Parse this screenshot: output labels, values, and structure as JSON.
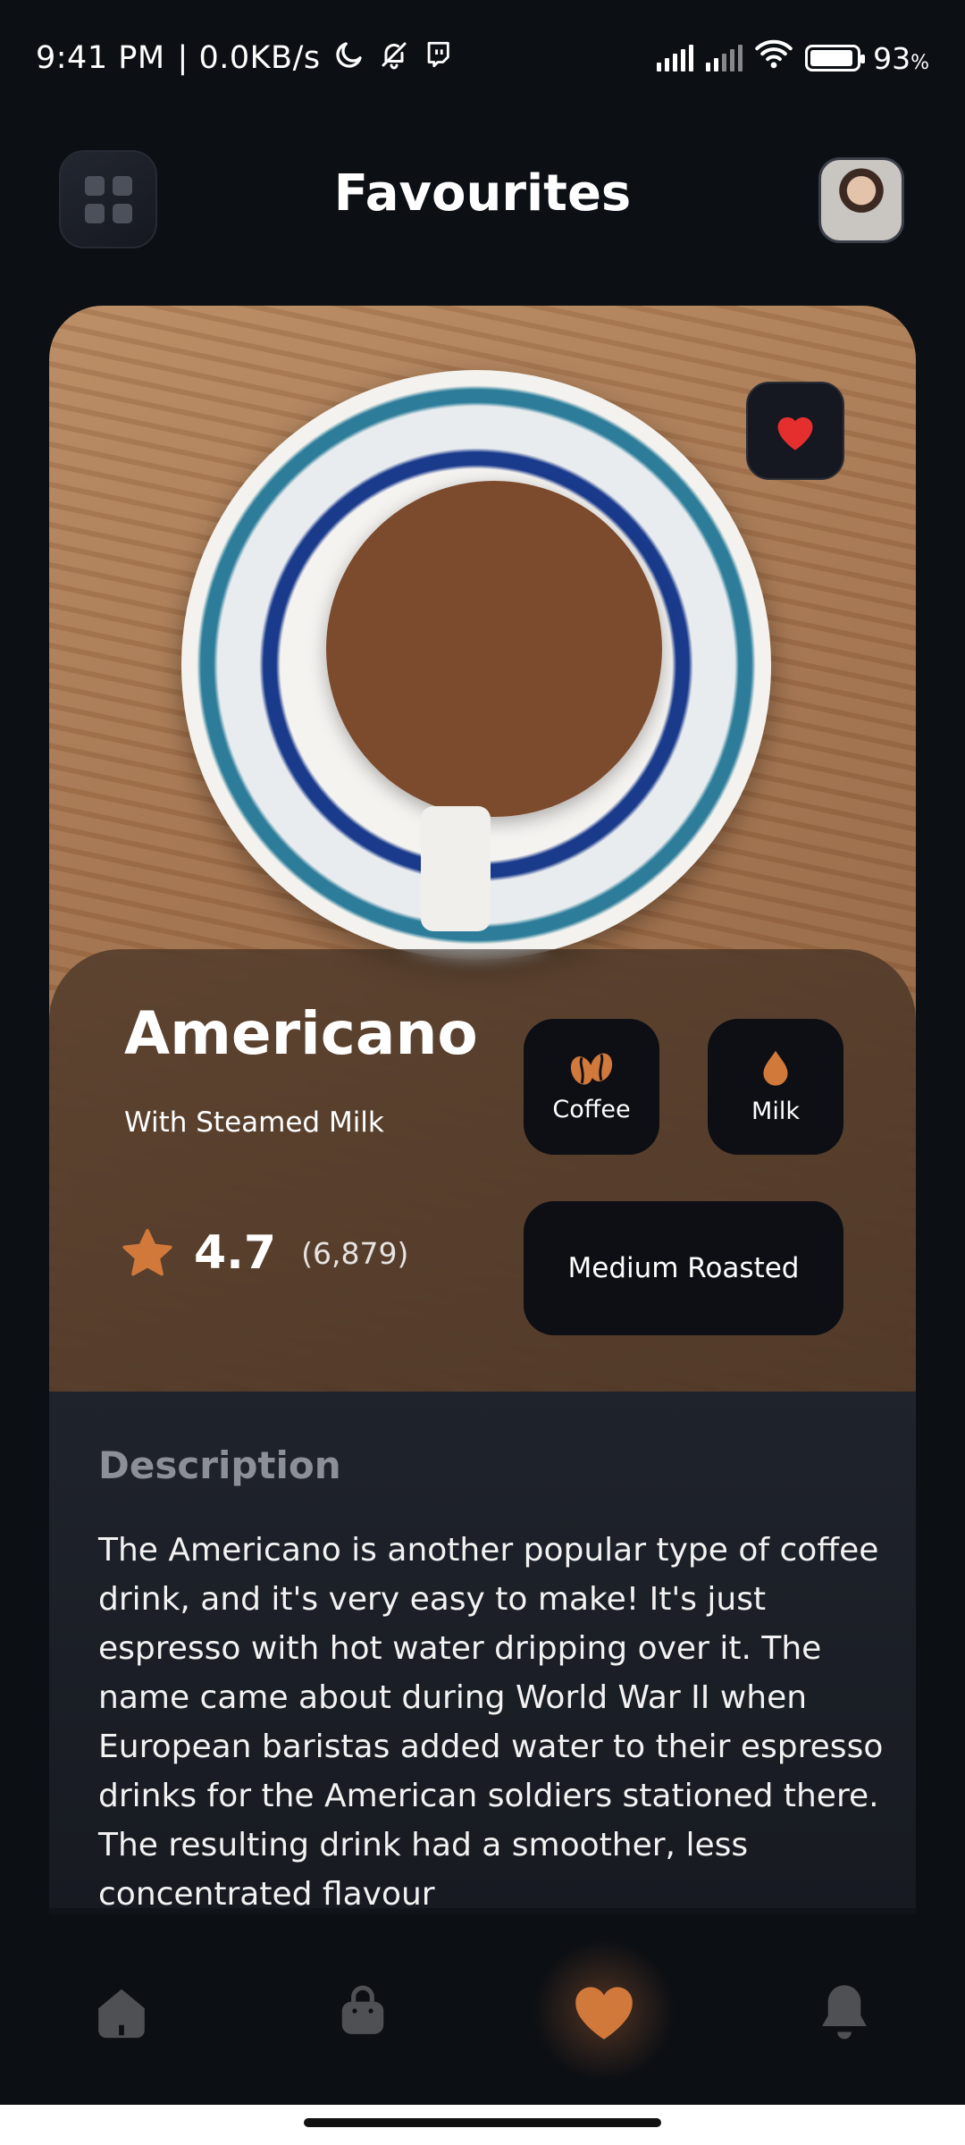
{
  "status_bar": {
    "time": "9:41 PM",
    "net_speed": "| 0.0KB/s",
    "battery": "93",
    "battery_unit": "%",
    "battery_level": 0.93,
    "icons": [
      "moon-icon",
      "bell-off-icon",
      "twitch-icon",
      "signal-icon",
      "signal-icon",
      "wifi-icon",
      "battery-icon"
    ]
  },
  "header": {
    "title": "Favourites",
    "menu_icon": "grid-icon",
    "avatar": "avatar"
  },
  "product": {
    "name": "Americano",
    "subtitle": "With Steamed Milk",
    "rating": "4.7",
    "rating_count": "(6,879)",
    "favorited": true,
    "chips": {
      "coffee": "Coffee",
      "milk": "Milk",
      "roast": "Medium Roasted"
    }
  },
  "description": {
    "title": "Description",
    "text": "The Americano is another popular type of coffee drink, and it's very easy to make! It's just espresso with hot water dripping over it. The name came about during World War II when European baristas added water to their espresso drinks for the American soldiers stationed there. The resulting drink had a smoother, less concentrated flavour"
  },
  "bottom_nav": {
    "items": [
      "home-icon",
      "bag-icon",
      "heart-icon",
      "bell-icon"
    ],
    "active": "heart-icon"
  },
  "colors": {
    "accent": "#D1783B",
    "background": "#0C0F14",
    "card_dark": "#0D0F14",
    "heart_red": "#E52E2E",
    "nav_inactive": "#4E5053"
  }
}
